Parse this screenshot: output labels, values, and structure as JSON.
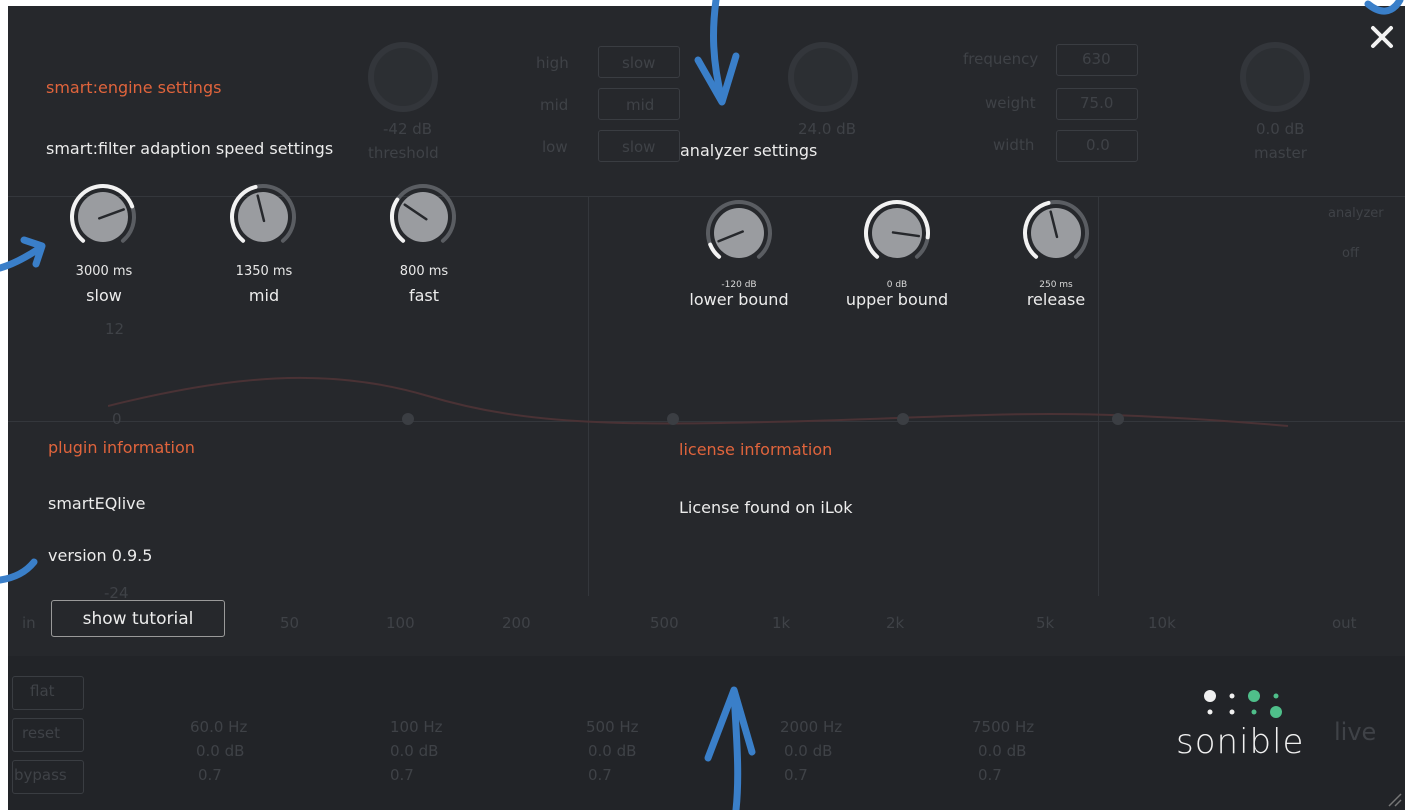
{
  "engine": {
    "section_title": "smart:engine settings",
    "subtitle": "smart:filter adaption speed settings",
    "knobs": [
      {
        "value": "3000 ms",
        "name": "slow",
        "level": 0.75
      },
      {
        "value": "1350 ms",
        "name": "mid",
        "level": 0.45
      },
      {
        "value": "800 ms",
        "name": "fast",
        "level": 0.3
      }
    ]
  },
  "analyzer": {
    "title": "analyzer settings",
    "knobs": [
      {
        "value": "-120 dB",
        "name": "lower bound",
        "level": 0.1
      },
      {
        "value": "0 dB",
        "name": "upper bound",
        "level": 0.85
      },
      {
        "value": "250 ms",
        "name": "release",
        "level": 0.45
      }
    ]
  },
  "plugin": {
    "section_title": "plugin information",
    "name": "smartEQlive",
    "version": "version 0.9.5",
    "tutorial_button": "show tutorial"
  },
  "license": {
    "section_title": "license information",
    "status": "License found on iLok"
  },
  "brand": {
    "logo_text": "sonible",
    "accent_color": "#e0643c",
    "dot_color": "#4fbf8a"
  },
  "background_ui": {
    "top_row": [
      "high",
      "mid",
      "low"
    ],
    "speed_values": [
      "slow",
      "mid",
      "slow"
    ],
    "threshold": "-42 dB",
    "threshold_label": "threshold",
    "gain": "24.0 dB",
    "frequency_label": "frequency",
    "frequency_value": "630",
    "weight_label": "weight",
    "weight_value": "75.0",
    "width_label": "width",
    "width_value": "0.0",
    "master_value": "0.0 dB",
    "master_label": "master",
    "freq_axis": [
      "in",
      "50",
      "100",
      "200",
      "500",
      "1k",
      "2k",
      "5k",
      "10k",
      "out"
    ],
    "db_axis": [
      "12",
      "0",
      "-24"
    ],
    "side_buttons": [
      "flat",
      "reset",
      "bypass"
    ],
    "band_freqs": [
      "60.0 Hz",
      "100 Hz",
      "500 Hz",
      "2000 Hz",
      "7500 Hz"
    ],
    "band_gain": "0.0 dB",
    "band_q": "0.7",
    "analyzer_label": "analyzer",
    "analyzer_state": "off",
    "live_label": "live"
  }
}
